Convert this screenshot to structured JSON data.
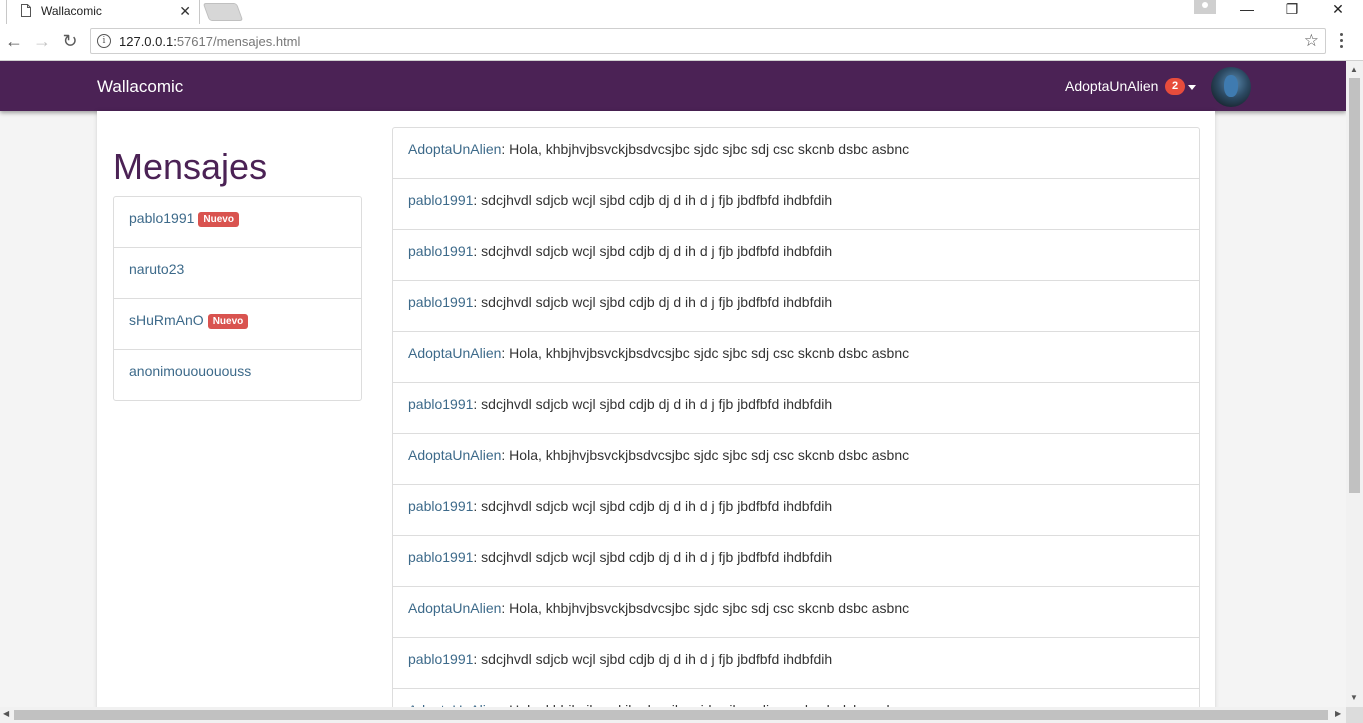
{
  "browser": {
    "tab_title": "Wallacomic",
    "tab_close": "✕",
    "url_host": "127.0.0.1:",
    "url_rest": "57617/mensajes.html",
    "window_minimize": "—",
    "window_restore": "❐",
    "window_close": "✕"
  },
  "navbar": {
    "brand": "Wallacomic",
    "username": "AdoptaUnAlien",
    "notification_count": "2",
    "accent_color": "#4b2255"
  },
  "page": {
    "title": "Mensajes"
  },
  "contacts": [
    {
      "name": "pablo1991",
      "badge": "Nuevo"
    },
    {
      "name": "naruto23",
      "badge": ""
    },
    {
      "name": "sHuRmAnO",
      "badge": "Nuevo"
    },
    {
      "name": "anonimououououss",
      "badge": ""
    }
  ],
  "messages": [
    {
      "author": "AdoptaUnAlien",
      "text": ": Hola, khbjhvjbsvckjbsdvcsjbc sjdc sjbc sdj csc skcnb dsbc asbnc"
    },
    {
      "author": "pablo1991",
      "text": ": sdcjhvdl sdjcb wcjl sjbd cdjb dj d ih d j fjb jbdfbfd ihdbfdih"
    },
    {
      "author": "pablo1991",
      "text": ": sdcjhvdl sdjcb wcjl sjbd cdjb dj d ih d j fjb jbdfbfd ihdbfdih"
    },
    {
      "author": "pablo1991",
      "text": ": sdcjhvdl sdjcb wcjl sjbd cdjb dj d ih d j fjb jbdfbfd ihdbfdih"
    },
    {
      "author": "AdoptaUnAlien",
      "text": ": Hola, khbjhvjbsvckjbsdvcsjbc sjdc sjbc sdj csc skcnb dsbc asbnc"
    },
    {
      "author": "pablo1991",
      "text": ": sdcjhvdl sdjcb wcjl sjbd cdjb dj d ih d j fjb jbdfbfd ihdbfdih"
    },
    {
      "author": "AdoptaUnAlien",
      "text": ": Hola, khbjhvjbsvckjbsdvcsjbc sjdc sjbc sdj csc skcnb dsbc asbnc"
    },
    {
      "author": "pablo1991",
      "text": ": sdcjhvdl sdjcb wcjl sjbd cdjb dj d ih d j fjb jbdfbfd ihdbfdih"
    },
    {
      "author": "pablo1991",
      "text": ": sdcjhvdl sdjcb wcjl sjbd cdjb dj d ih d j fjb jbdfbfd ihdbfdih"
    },
    {
      "author": "AdoptaUnAlien",
      "text": ": Hola, khbjhvjbsvckjbsdvcsjbc sjdc sjbc sdj csc skcnb dsbc asbnc"
    },
    {
      "author": "pablo1991",
      "text": ": sdcjhvdl sdjcb wcjl sjbd cdjb dj d ih d j fjb jbdfbfd ihdbfdih"
    },
    {
      "author": "AdoptaUnAlien",
      "text": ": Hola, khbjhvjbsvckjbsdvcsjbc sjdc sjbc sdj csc skcnb dsbc asbnc"
    }
  ]
}
